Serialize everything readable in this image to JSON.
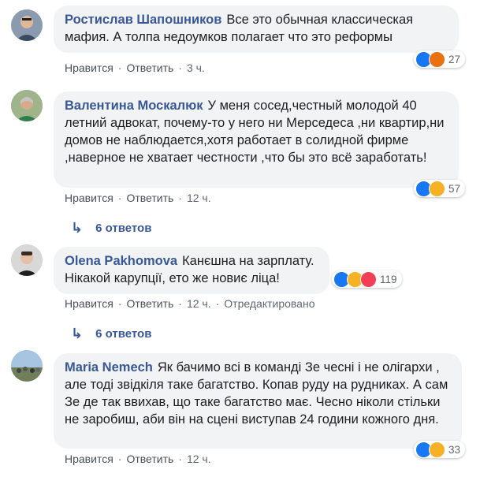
{
  "comments": [
    {
      "author": "Ростислав Шапошников",
      "text": "Все это обычная классическая мафия. А толпа недоумков полагает что это реформы",
      "like": "Нравится",
      "reply": "Ответить",
      "time": "3 ч.",
      "reactions": [
        "like-icon",
        "angry-icon"
      ],
      "count": "27"
    },
    {
      "author": "Валентина Москалюк",
      "text": "У меня сосед,честный молодой 40 летний адвокат, почему-то у него ни Мерседеса ,ни квартир,ни домов не наблюдается,хотя работает в солидной фирме ,наверное не хватает честности ,что бы это всё заработать!",
      "like": "Нравится",
      "reply": "Ответить",
      "time": "12 ч.",
      "reactions": [
        "like-icon",
        "haha-icon"
      ],
      "count": "57",
      "replies_label": "6 ответов"
    },
    {
      "author": "Olena Pakhomova",
      "text": "Канєшна на зарплату. Нікакой карупції, ето же новиє ліца!",
      "like": "Нравится",
      "reply": "Ответить",
      "time": "12 ч.",
      "edited": "Отредактировано",
      "reactions": [
        "like-icon",
        "haha-icon",
        "love-icon"
      ],
      "count": "119",
      "replies_label": "6 ответов"
    },
    {
      "author": "Maria Nemech",
      "text": "Як бачимо всі в команді Зе чесні і не олігархи , але тоді звідкіля таке багатство. Копав руду на рудниках. А сам Зе де так ввихав, що таке багатство має. Чесно ніколи стільки не заробиш, аби він на сцені виступав 24 години кожного дня.",
      "like": "Нравится",
      "reply": "Ответить",
      "time": "12 ч.",
      "reactions": [
        "like-icon",
        "haha-icon"
      ],
      "count": "33"
    }
  ],
  "colors": {
    "author": "#385898",
    "bubble": "#f2f3f5",
    "like": "#1877f2",
    "angry": "#e9710f",
    "haha": "#f7b125",
    "love": "#f33e58"
  }
}
